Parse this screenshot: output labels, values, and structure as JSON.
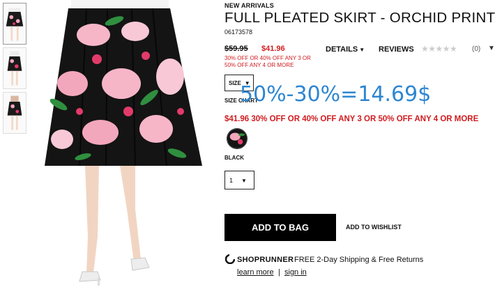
{
  "thumbnails": [
    {
      "alt": "",
      "active": true
    },
    {
      "alt": "",
      "active": false
    },
    {
      "alt": "",
      "active": false
    }
  ],
  "product": {
    "category": "NEW ARRIVALS",
    "title": "FULL PLEATED SKIRT - ORCHID PRINT",
    "sku": "06173578",
    "price_old": "$59.95",
    "price_new": "$41.96",
    "promo_short": "30% OFF OR 40% OFF ANY 3 OR 50% OFF ANY 4 OR MORE"
  },
  "tabs": {
    "details": "DETAILS",
    "reviews": "REVIEWS",
    "stars": "★★★★★",
    "review_count": "(0)"
  },
  "size": {
    "label": "SIZE",
    "chart_link": "SIZE CHART"
  },
  "annotation": "50%-30%=14.69$",
  "promo_line": "$41.96 30% OFF OR 40% OFF ANY 3 OR 50% OFF ANY 4 OR MORE",
  "color": {
    "label": "BLACK"
  },
  "quantity": {
    "value": "1"
  },
  "actions": {
    "add_to_bag": "ADD TO BAG",
    "add_to_wishlist": "ADD TO WISHLIST"
  },
  "shoprunner": {
    "brand": "SHOPRUNNER",
    "text": "FREE 2-Day Shipping & Free Returns",
    "learn_more": "learn more",
    "separator": "|",
    "sign_in": "sign in"
  },
  "colors": {
    "sale_red": "#d01c1f",
    "annotation_blue": "#2e86d1",
    "button_black": "#000000"
  }
}
